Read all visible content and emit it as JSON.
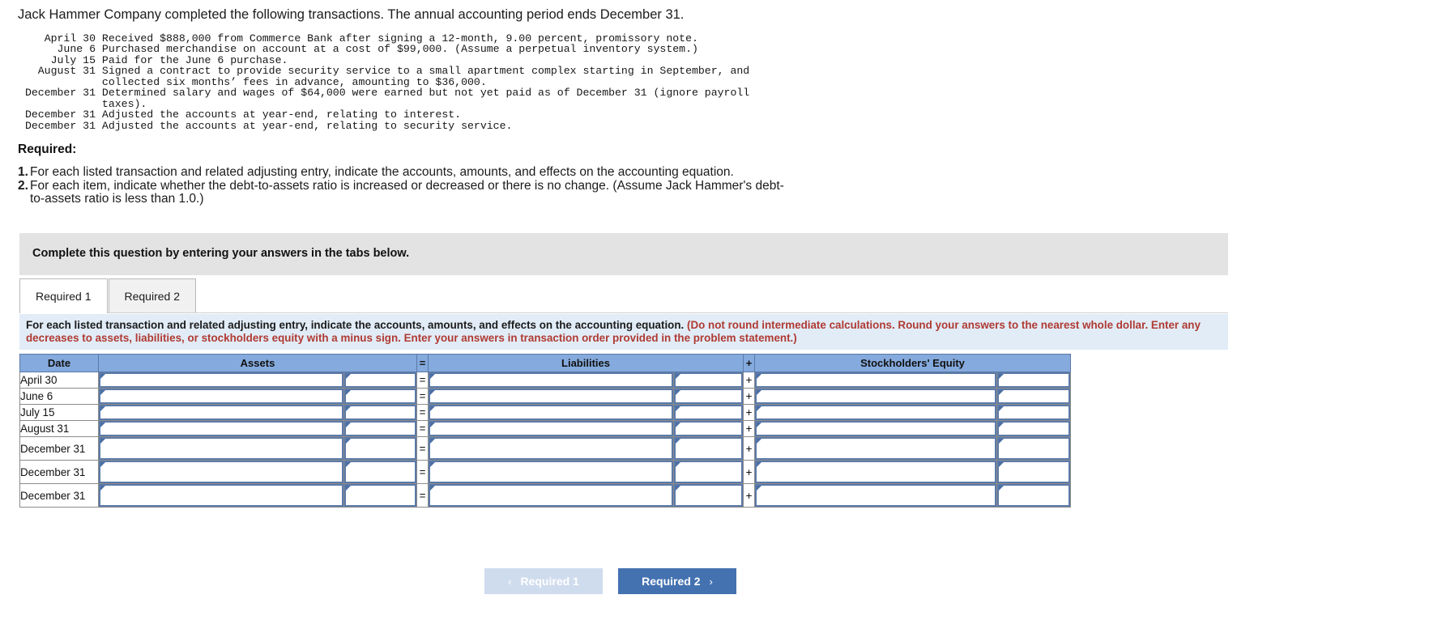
{
  "intro": "Jack Hammer Company completed the following transactions. The annual accounting period ends December 31.",
  "transactions": [
    {
      "date": "April 30",
      "lines": [
        "Received $888,000 from Commerce Bank after signing a 12-month, 9.00 percent, promissory note."
      ]
    },
    {
      "date": "June 6",
      "lines": [
        "Purchased merchandise on account at a cost of $99,000. (Assume a perpetual inventory system.)"
      ]
    },
    {
      "date": "July 15",
      "lines": [
        "Paid for the June 6 purchase."
      ]
    },
    {
      "date": "August 31",
      "lines": [
        "Signed a contract to provide security service to a small apartment complex starting in September, and",
        "collected six months’ fees in advance, amounting to $36,000."
      ]
    },
    {
      "date": "December 31",
      "lines": [
        "Determined salary and wages of $64,000 were earned but not yet paid as of December 31 (ignore payroll",
        "taxes)."
      ]
    },
    {
      "date": "December 31",
      "lines": [
        "Adjusted the accounts at year-end, relating to interest."
      ]
    },
    {
      "date": "December 31",
      "lines": [
        "Adjusted the accounts at year-end, relating to security service."
      ]
    }
  ],
  "required_heading": "Required:",
  "required_items": [
    {
      "num": "1.",
      "text": "For each listed transaction and related adjusting entry, indicate the accounts, amounts, and effects on the accounting equation."
    },
    {
      "num": "2.",
      "text": "For each item, indicate whether the debt-to-assets ratio is increased or decreased or there is no change. (Assume Jack Hammer's debt-to-assets ratio is less than 1.0.)"
    }
  ],
  "banner": {
    "text": "Complete this question by entering your answers in the tabs below."
  },
  "tabs": [
    {
      "label": "Required 1",
      "active": true
    },
    {
      "label": "Required 2",
      "active": false
    }
  ],
  "instruction": {
    "black": "For each listed transaction and related adjusting entry, indicate the accounts, amounts, and effects on the accounting equation.",
    "red": "(Do not round intermediate calculations. Round your answers to the nearest whole dollar. Enter any decreases to assets, liabilities, or stockholders equity with a minus sign. Enter your answers in transaction order provided in the problem statement.)"
  },
  "table": {
    "headers": {
      "date": "Date",
      "assets": "Assets",
      "equals": "=",
      "liabilities": "Liabilities",
      "plus": "+",
      "equity": "Stockholders' Equity"
    },
    "rows": [
      {
        "date": "April 30",
        "assets_account": "",
        "assets_amount": "",
        "eq": "=",
        "liab_account": "",
        "liab_amount": "",
        "plus": "+",
        "se_account": "",
        "se_amount": "",
        "tall": false
      },
      {
        "date": "June 6",
        "assets_account": "",
        "assets_amount": "",
        "eq": "=",
        "liab_account": "",
        "liab_amount": "",
        "plus": "+",
        "se_account": "",
        "se_amount": "",
        "tall": false
      },
      {
        "date": "July 15",
        "assets_account": "",
        "assets_amount": "",
        "eq": "=",
        "liab_account": "",
        "liab_amount": "",
        "plus": "+",
        "se_account": "",
        "se_amount": "",
        "tall": false
      },
      {
        "date": "August 31",
        "assets_account": "",
        "assets_amount": "",
        "eq": "=",
        "liab_account": "",
        "liab_amount": "",
        "plus": "+",
        "se_account": "",
        "se_amount": "",
        "tall": false
      },
      {
        "date": "December 31",
        "assets_account": "",
        "assets_amount": "",
        "eq": "=",
        "liab_account": "",
        "liab_amount": "",
        "plus": "+",
        "se_account": "",
        "se_amount": "",
        "tall": true
      },
      {
        "date": "December 31",
        "assets_account": "",
        "assets_amount": "",
        "eq": "=",
        "liab_account": "",
        "liab_amount": "",
        "plus": "+",
        "se_account": "",
        "se_amount": "",
        "tall": true
      },
      {
        "date": "December 31",
        "assets_account": "",
        "assets_amount": "",
        "eq": "=",
        "liab_account": "",
        "liab_amount": "",
        "plus": "+",
        "se_account": "",
        "se_amount": "",
        "tall": true
      }
    ]
  },
  "nav": {
    "prev_label": "Required 1",
    "prev_chevron": "‹",
    "next_label": "Required 2",
    "next_chevron": "›"
  },
  "colors": {
    "header_blue": "#85aadd",
    "input_border": "#5b7aa8",
    "instruction_bg": "#e1ecf7",
    "red_text": "#b03a32",
    "banner_gray": "#e3e3e3",
    "btn_primary": "#4472b0",
    "btn_disabled": "#cfdcee"
  }
}
